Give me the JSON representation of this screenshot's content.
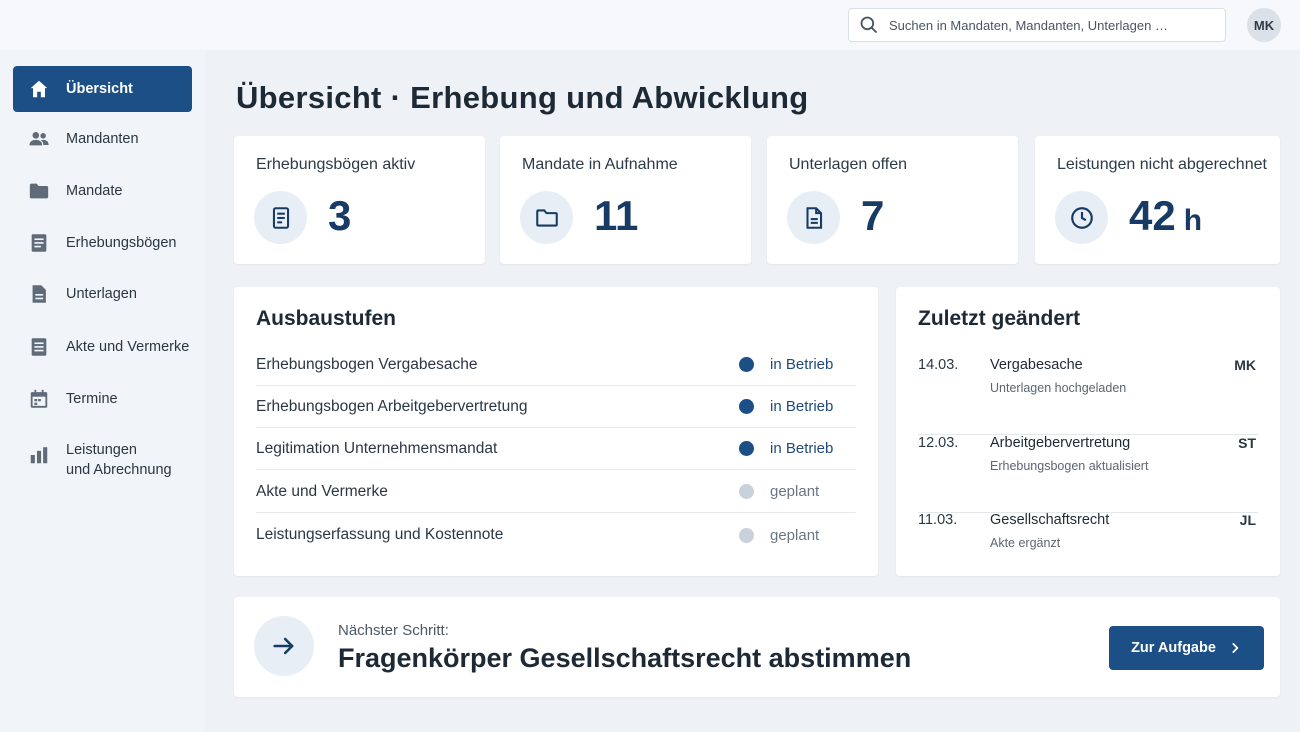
{
  "search": {
    "placeholder": "Suchen in Mandaten, Mandanten, Unterlagen …"
  },
  "user": {
    "initials": "MK"
  },
  "sidebar": {
    "items": [
      {
        "label": "Übersicht",
        "icon": "home-icon",
        "active": true
      },
      {
        "label": "Mandanten",
        "icon": "people-icon"
      },
      {
        "label": "Mandate",
        "icon": "folder-icon"
      },
      {
        "label": "Erhebungsbögen",
        "icon": "form-icon"
      },
      {
        "label": "Unterlagen",
        "icon": "document-icon"
      },
      {
        "label": "Akte und Vermerke",
        "icon": "notes-icon"
      },
      {
        "label": "Termine",
        "icon": "calendar-icon"
      },
      {
        "label_line1": "Leistungen",
        "label_line2": "und Abrechnung",
        "icon": "bar-chart-icon"
      }
    ]
  },
  "page": {
    "title": "Übersicht · Erhebung und Abwicklung"
  },
  "stats": [
    {
      "label": "Erhebungsbögen aktiv",
      "value": "3",
      "icon": "form-icon"
    },
    {
      "label": "Mandate in Aufnahme",
      "value": "11",
      "icon": "folder-icon"
    },
    {
      "label": "Unterlagen offen",
      "value": "7",
      "icon": "document-icon"
    },
    {
      "label": "Leistungen nicht abgerechnet",
      "value": "42",
      "unit": "h",
      "icon": "clock-icon"
    }
  ],
  "stages": {
    "title": "Ausbaustufen",
    "rows": [
      {
        "name": "Erhebungsbogen Vergabesache",
        "status": "in Betrieb"
      },
      {
        "name": "Erhebungsbogen Arbeitgebervertretung",
        "status": "in Betrieb"
      },
      {
        "name": "Legitimation Unternehmensmandat",
        "status": "in Betrieb"
      },
      {
        "name": "Akte und Vermerke",
        "status": "geplant"
      },
      {
        "name": "Leistungserfassung und Kostennote",
        "status": "geplant"
      }
    ]
  },
  "recent": {
    "title": "Zuletzt geändert",
    "rows": [
      {
        "date": "14.03.",
        "title": "Vergabesache",
        "sub": "Unterlagen hochgeladen",
        "user": "MK"
      },
      {
        "date": "12.03.",
        "title": "Arbeitgebervertretung",
        "sub": "Erhebungsbogen aktualisiert",
        "user": "ST"
      },
      {
        "date": "11.03.",
        "title": "Gesellschaftsrecht",
        "sub": "Akte ergänzt",
        "user": "JL"
      }
    ]
  },
  "next": {
    "label": "Nächster Schritt:",
    "title": "Fragenkörper Gesellschaftsrecht abstimmen",
    "button": "Zur Aufgabe",
    "icon": "arrow-right-icon"
  },
  "colors": {
    "accent": "#1b4f86",
    "status_active": "#1b4f86",
    "status_planned": "#c9d1da"
  }
}
